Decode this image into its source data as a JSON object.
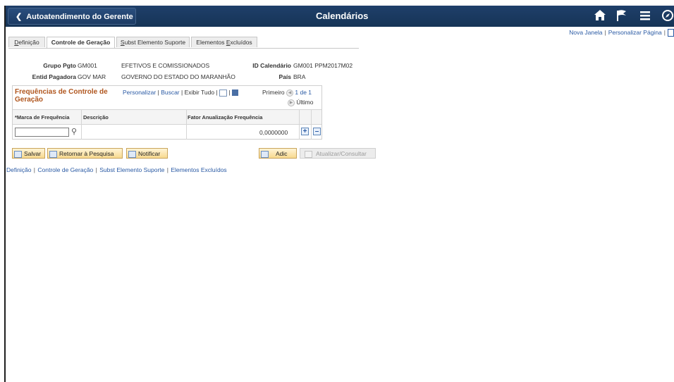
{
  "header": {
    "back_label": "Autoatendimento do Gerente",
    "title": "Calendários",
    "icons": [
      "home-icon",
      "flag-icon",
      "menu-icon",
      "navbar-icon"
    ]
  },
  "top_links": {
    "new_window": "Nova Janela",
    "personalize_page": "Personalizar Página"
  },
  "tabs": [
    {
      "prefix": "D",
      "label": "efinição"
    },
    {
      "label": "Controle de Geração",
      "active": true
    },
    {
      "prefix": "S",
      "label": "ubst Elemento Suporte"
    },
    {
      "prefix_text": "Elementos ",
      "underline": "E",
      "label": "xcluídos"
    }
  ],
  "form": {
    "grupo_pgto_label": "Grupo Pgto",
    "grupo_pgto_code": "GM001",
    "grupo_pgto_desc": "EFETIVOS E COMISSIONADOS",
    "id_calendario_label": "ID Calendário",
    "id_calendario_value": "GM001 PPM2017M02",
    "entid_label": "Entid Pagadora",
    "entid_code": "GOV MAR",
    "entid_desc": "GOVERNO DO ESTADO DO MARANHÃO",
    "pais_label": "País",
    "pais_value": "BRA"
  },
  "grid": {
    "title": "Frequências de Controle de Geração",
    "personalize": "Personalizar",
    "find": "Buscar",
    "show_all": "Exibir Tudo",
    "first": "Primeiro",
    "range": "1 de 1",
    "last": "Último",
    "columns": [
      "*Marca de Frequência",
      "Descrição",
      "Fator Anualização Frequência"
    ],
    "rows": [
      {
        "marca": "",
        "descricao": "",
        "fator": "0,0000000"
      }
    ]
  },
  "buttons": {
    "save": "Salvar",
    "return_search": "Retornar à Pesquisa",
    "notify": "Notificar",
    "add": "Adic",
    "update_display": "Atualizar/Consultar"
  },
  "footer_links": [
    "Definição",
    "Controle de Geração",
    "Subst Elemento Suporte",
    "Elementos Excluídos"
  ],
  "colors": {
    "header_bg": "#1f3f6a",
    "link": "#2a5aa4",
    "grid_title": "#b0561e",
    "button_bg": "#f7d98f"
  }
}
